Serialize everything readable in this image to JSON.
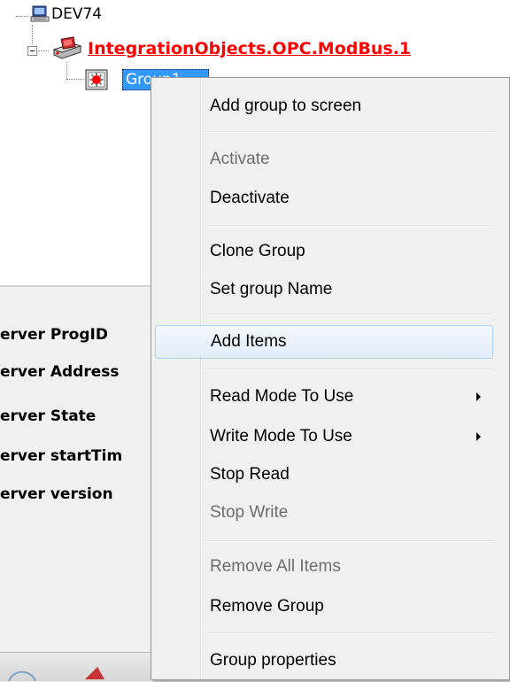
{
  "tree": {
    "root": {
      "label": "DEV74",
      "icon": "computer-icon"
    },
    "server": {
      "label": "IntegrationObjects.OPC.ModBus.1",
      "icon": "opc-server-icon",
      "color": "#ff0000"
    },
    "group": {
      "label": "Group1",
      "icon": "group-icon"
    }
  },
  "properties": {
    "labels": [
      "erver ProgID",
      "erver Address",
      "erver State",
      "erver startTim",
      "erver version"
    ],
    "right_clip": "B"
  },
  "context_menu": {
    "items": [
      {
        "label": "Add group to screen",
        "enabled": true
      },
      {
        "label": "Activate",
        "enabled": false
      },
      {
        "label": "Deactivate",
        "enabled": true
      },
      {
        "label": "Clone Group",
        "enabled": true
      },
      {
        "label": "Set group Name",
        "enabled": true
      },
      {
        "label": "Add Items",
        "enabled": true,
        "highlighted": true
      },
      {
        "label": "Read Mode To Use",
        "enabled": true,
        "submenu": true
      },
      {
        "label": "Write Mode To Use",
        "enabled": true,
        "submenu": true
      },
      {
        "label": "Stop Read",
        "enabled": true
      },
      {
        "label": "Stop Write",
        "enabled": false
      },
      {
        "label": "Remove All Items",
        "enabled": false
      },
      {
        "label": "Remove Group",
        "enabled": true
      },
      {
        "label": "Group properties",
        "enabled": true
      }
    ],
    "highlight_color": "#aecff7"
  }
}
